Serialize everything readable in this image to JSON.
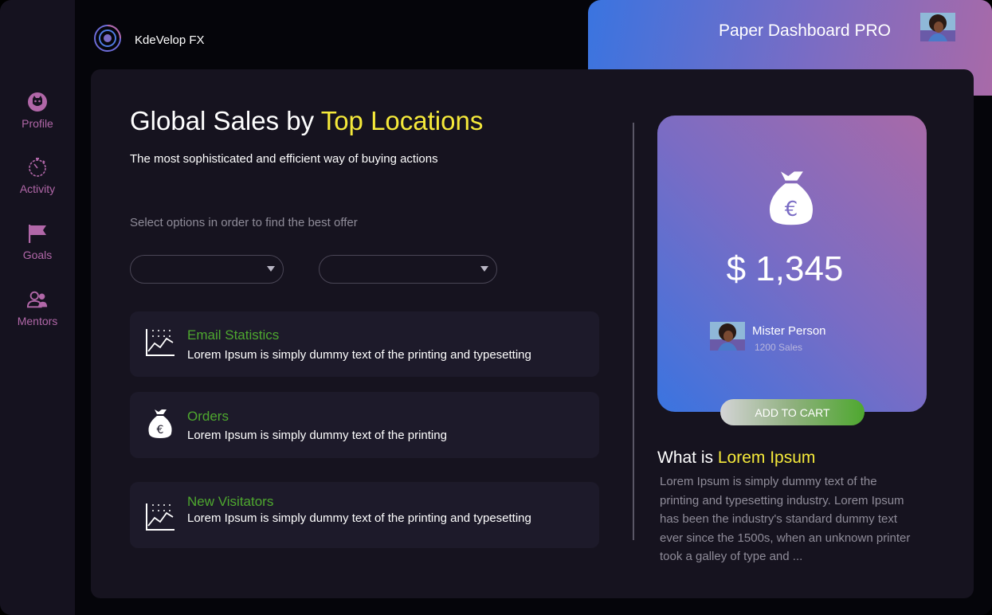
{
  "app": {
    "brand": "KdeVelop FX"
  },
  "header": {
    "title": "Paper Dashboard PRO"
  },
  "sidebar": {
    "items": [
      {
        "label": "Profile",
        "icon": "profile-icon"
      },
      {
        "label": "Activity",
        "icon": "stopwatch-icon"
      },
      {
        "label": "Goals",
        "icon": "flag-icon"
      },
      {
        "label": "Mentors",
        "icon": "users-icon"
      }
    ]
  },
  "main": {
    "title_prefix": "Global Sales by ",
    "title_accent": "Top Locations",
    "subtitle": "The most sophisticated and efficient way of buying actions",
    "hint": "Select options in order to find the best offer",
    "features": [
      {
        "title": "Email Statistics",
        "desc": "Lorem Ipsum is simply dummy text of the printing and typesetting",
        "icon": "chart-icon"
      },
      {
        "title": "Orders",
        "desc": "Lorem Ipsum is simply dummy text of the printing",
        "icon": "money-bag-icon"
      },
      {
        "title": "New Visitators",
        "desc": "Lorem Ipsum is simply dummy text of the printing and typesetting",
        "icon": "chart-icon"
      }
    ]
  },
  "promo": {
    "price": "$ 1,345",
    "person_name": "Mister Person",
    "person_sales": "1200 Sales",
    "cta": "ADD TO CART"
  },
  "about": {
    "title_prefix": "What is ",
    "title_accent": "Lorem Ipsum",
    "text": "Lorem Ipsum is simply dummy text of the printing and typesetting industry. Lorem Ipsum has been the industry's standard dummy text ever since the 1500s, when an unknown printer took a galley of type and ..."
  },
  "colors": {
    "accent_yellow": "#f5e93a",
    "accent_green": "#4ea82f",
    "sidebar_pink": "#b167a8",
    "gradient_blue": "#3a74e0",
    "gradient_purple": "#a86aa8"
  }
}
